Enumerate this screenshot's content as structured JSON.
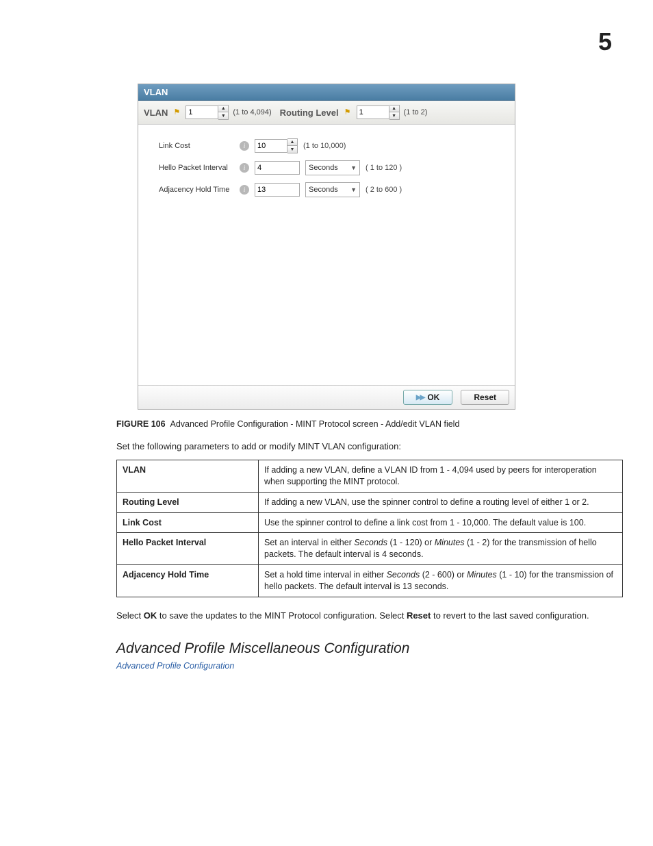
{
  "chapter": "5",
  "panel": {
    "title": "VLAN",
    "toprow": {
      "vlan_label": "VLAN",
      "vlan_value": "1",
      "vlan_range": "(1 to 4,094)",
      "routing_label": "Routing Level",
      "routing_value": "1",
      "routing_range": "(1 to 2)"
    },
    "fields": {
      "link_cost": {
        "label": "Link Cost",
        "value": "10",
        "range": "(1 to 10,000)"
      },
      "hello": {
        "label": "Hello Packet Interval",
        "value": "4",
        "unit": "Seconds",
        "range": "( 1 to 120 )"
      },
      "adjacency": {
        "label": "Adjacency Hold Time",
        "value": "13",
        "unit": "Seconds",
        "range": "( 2 to 600 )"
      }
    },
    "buttons": {
      "ok": "OK",
      "reset": "Reset"
    }
  },
  "caption_label": "FIGURE 106",
  "caption_text": "Advanced Profile Configuration - MINT Protocol screen - Add/edit VLAN field",
  "intro_text": "Set the following parameters to add or modify MINT VLAN configuration:",
  "params": [
    {
      "name": "VLAN",
      "desc": "If adding a new VLAN, define a VLAN ID from 1 - 4,094 used by peers for interoperation when supporting the MINT protocol."
    },
    {
      "name": "Routing Level",
      "desc": "If adding a new VLAN, use the spinner control to define a routing level of either 1 or 2."
    },
    {
      "name": "Link Cost",
      "desc": "Use the spinner control to define a link cost from 1 - 10,000. The default value is 100."
    },
    {
      "name": "Hello Packet Interval",
      "desc_pre": "Set an interval in either ",
      "i1": "Seconds",
      "mid1": " (1 - 120) or ",
      "i2": "Minutes",
      "mid2": " (1 - 2) for the transmission of hello packets. The default interval is 4 seconds."
    },
    {
      "name": "Adjacency Hold Time",
      "desc_pre": "Set a hold time interval in either ",
      "i1": "Seconds",
      "mid1": " (2 - 600) or ",
      "i2": "Minutes",
      "mid2": " (1 - 10) for the transmission of hello packets. The default interval is 13 seconds."
    }
  ],
  "after_pre": "Select ",
  "after_ok": "OK",
  "after_mid": " to save the updates to the MINT Protocol configuration. Select ",
  "after_reset": "Reset",
  "after_end": " to revert to the last saved configuration.",
  "section_heading": "Advanced Profile Miscellaneous Configuration",
  "breadcrumb_link": "Advanced Profile Configuration"
}
